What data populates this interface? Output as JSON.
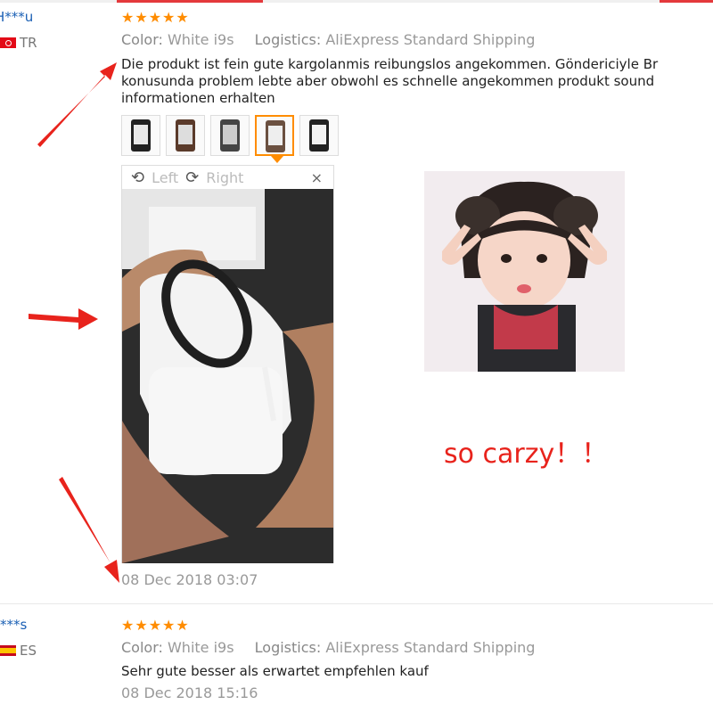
{
  "reviews": [
    {
      "user": "H***u",
      "country": "TR",
      "stars": "★★★★★",
      "color_label": "Color:",
      "color_value": "White i9s",
      "logistics_label": "Logistics:",
      "logistics_value": "AliExpress Standard Shipping",
      "text_lines": [
        "Die produkt ist fein gute kargolanmis reibungslos angekommen. Göndericiyle Br",
        "konusunda problem lebte aber obwohl es schnelle angekommen produkt sound",
        "informationen erhalten"
      ],
      "viewer": {
        "left": "Left",
        "right": "Right",
        "close": "×"
      },
      "date": "08 Dec 2018 03:07"
    },
    {
      "user": "***s",
      "country": "ES",
      "stars": "★★★★★",
      "color_label": "Color:",
      "color_value": "White i9s",
      "logistics_label": "Logistics:",
      "logistics_value": "AliExpress Standard Shipping",
      "text": "Sehr gute besser als erwartet empfehlen kauf",
      "date": "08 Dec 2018 15:16"
    }
  ],
  "annotation_text": "so carzy！！",
  "colors": {
    "star": "#ff8c00",
    "user": "#1a5fb4",
    "annotation": "#e8231c",
    "active_thumb": "#ff8c00"
  }
}
